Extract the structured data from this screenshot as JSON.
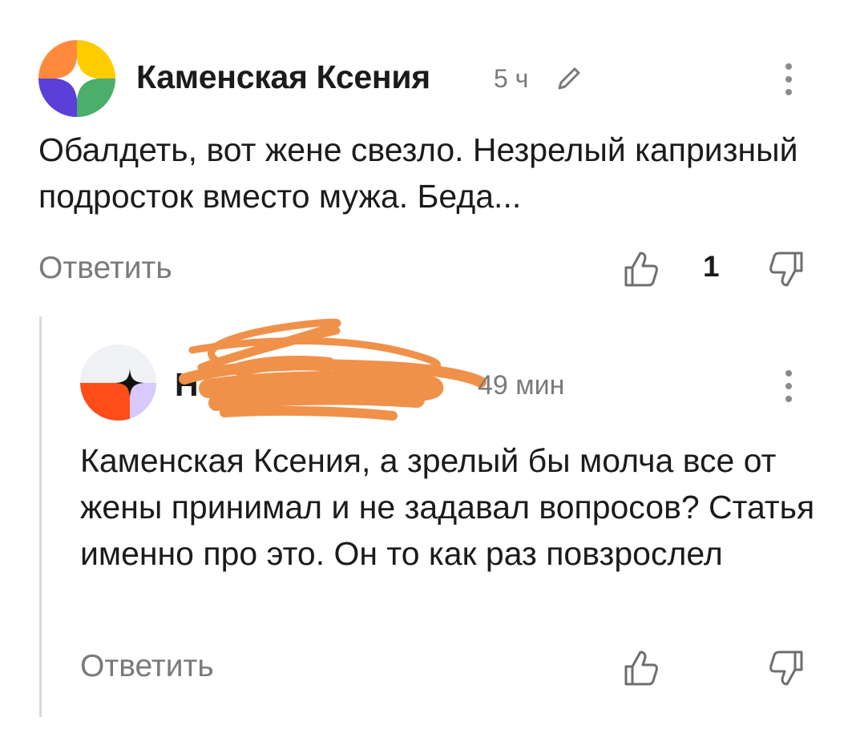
{
  "comments": [
    {
      "author": "Каменская Ксения",
      "time": "5 ч",
      "edited": true,
      "text": "Обалдеть, вот жене свезло. Незрелый капризный подросток вместо мужа. Беда...",
      "reply_label": "Ответить",
      "likes": "1",
      "avatar_colors": [
        "#ff8a3d",
        "#ffcc00",
        "#5b3fd8",
        "#4cae6b"
      ]
    },
    {
      "author": "Н",
      "author_obscured": true,
      "time": "49 мин",
      "text": "Каменская Ксения, а зрелый бы молча все от жены принимал и не задавал вопросов? Статья именно про это. Он то как раз повзрослел",
      "reply_label": "Ответить",
      "likes": "",
      "avatar_colors": [
        "#f0f1f4",
        "#ff4d1a",
        "#d8c9ff"
      ]
    }
  ],
  "icons": {
    "edit": "pencil-icon",
    "menu": "kebab-menu-icon",
    "like": "thumbs-up-icon",
    "dislike": "thumbs-down-icon"
  },
  "colors": {
    "scribble": "#f0914a",
    "muted_text": "#7a7a7a",
    "thread_line": "#d9d9d9"
  }
}
